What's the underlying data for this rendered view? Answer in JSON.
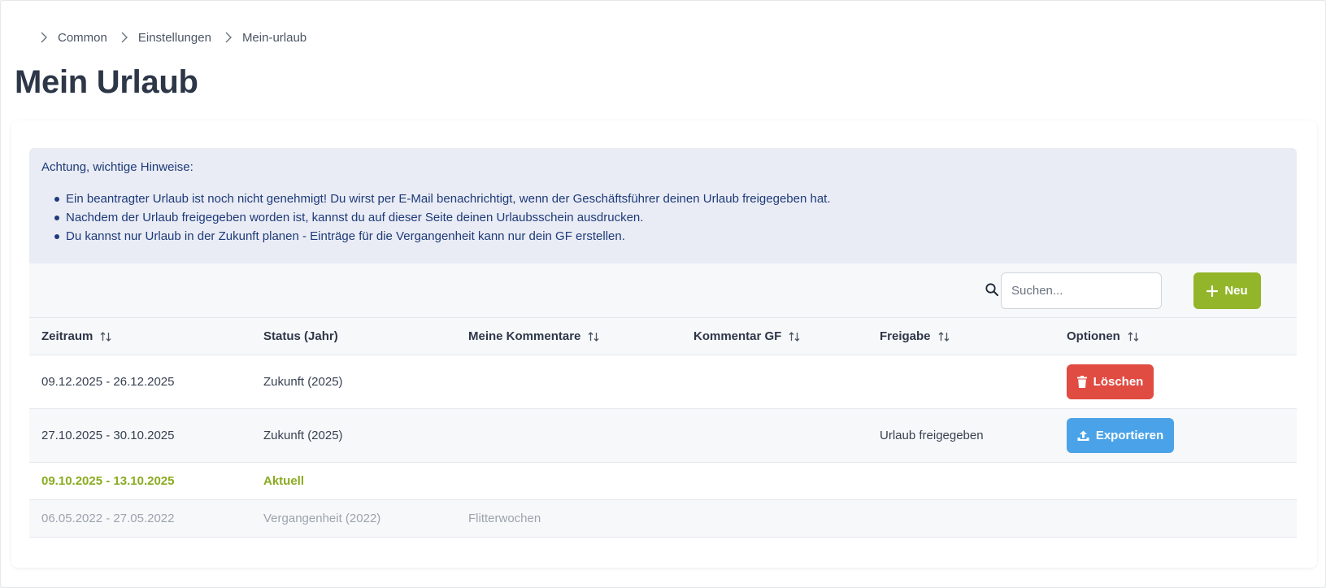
{
  "breadcrumb": [
    "Common",
    "Einstellungen",
    "Mein-urlaub"
  ],
  "page_title": "Mein Urlaub",
  "notice": {
    "title": "Achtung, wichtige Hinweise:",
    "items": [
      "Ein beantragter Urlaub ist noch nicht genehmigt! Du wirst per E-Mail benachrichtigt, wenn der Geschäftsführer deinen Urlaub freigegeben hat.",
      "Nachdem der Urlaub freigegeben worden ist, kannst du auf dieser Seite deinen Urlaubsschein ausdrucken.",
      "Du kannst nur Urlaub in der Zukunft planen - Einträge für die Vergangenheit kann nur dein GF erstellen."
    ]
  },
  "toolbar": {
    "search_placeholder": "Suchen...",
    "new_label": "Neu"
  },
  "table": {
    "columns": [
      "Zeitraum",
      "Status (Jahr)",
      "Meine Kommentare",
      "Kommentar GF",
      "Freigabe",
      "Optionen"
    ],
    "rows": [
      {
        "period": "09.12.2025 - 26.12.2025",
        "status": "Zukunft (2025)",
        "comment": "",
        "gf_comment": "",
        "approval": "",
        "action": "Löschen"
      },
      {
        "period": "27.10.2025 - 30.10.2025",
        "status": "Zukunft (2025)",
        "comment": "",
        "gf_comment": "",
        "approval": "Urlaub freigegeben",
        "action": "Exportieren"
      },
      {
        "period": "09.10.2025 - 13.10.2025",
        "status": "Aktuell",
        "comment": "",
        "gf_comment": "",
        "approval": "",
        "action": ""
      },
      {
        "period": "06.05.2022 - 27.05.2022",
        "status": "Vergangenheit (2022)",
        "comment": "Flitterwochen",
        "gf_comment": "",
        "approval": "",
        "action": ""
      }
    ]
  },
  "colors": {
    "accent_green": "#93b52a",
    "danger_red": "#e04b42",
    "info_blue": "#4aa3e8",
    "notice_text": "#1e3a7a"
  },
  "icons": {
    "breadcrumb_separator": "chevron-right-icon",
    "search": "search-icon",
    "new": "plus-icon",
    "sort": "sort-icon",
    "delete": "trash-icon",
    "export": "upload-icon"
  }
}
